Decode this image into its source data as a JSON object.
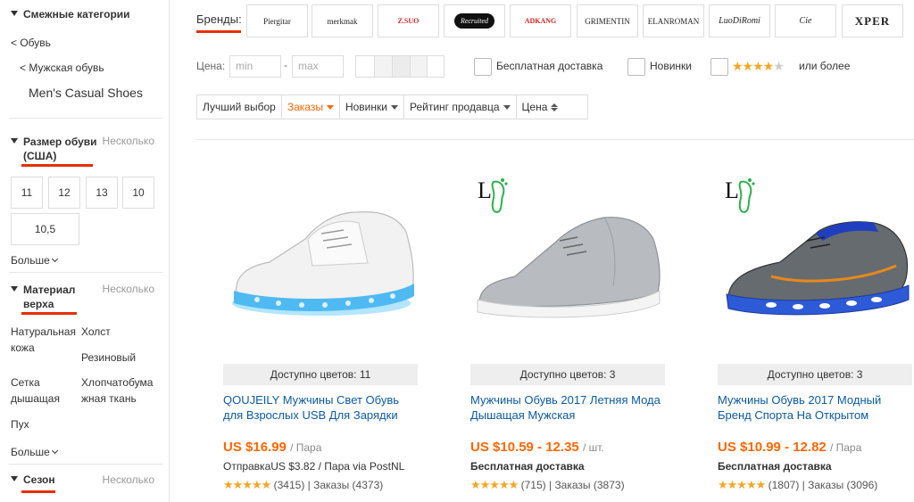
{
  "sidebar": {
    "related_title": "Смежные категории",
    "cat_shoes": "< Обувь",
    "cat_mens": "< Мужская обувь",
    "cat_casual": "Men's Casual Shoes",
    "size_title_1": "Размер обуви",
    "size_title_2": "(США)",
    "multi": "Несколько",
    "sizes": [
      "11",
      "12",
      "13",
      "10",
      "10,5"
    ],
    "more": "Больше",
    "material_title_1": "Материал",
    "material_title_2": "верха",
    "materials": [
      "Натуральная кожа",
      "Холст",
      "Резиновый",
      "Сетка дышащая",
      "Хлопчатобумажная ткань",
      "Пух"
    ],
    "season_title": "Сезон"
  },
  "filters": {
    "brands_label": "Бренды:",
    "brands": [
      "Piergitar",
      "merkmak",
      "Z.SUO",
      "Recruited",
      "ADKANG",
      "GRIMENTIN",
      "ELANROMAN",
      "LuoDiRomi",
      "Cie",
      "XPER"
    ],
    "price_label": "Цена:",
    "price_min_placeholder": "min",
    "price_max_placeholder": "max",
    "price_dash": "-",
    "free_shipping": "Бесплатная доставка",
    "new_items": "Новинки",
    "rating_or_more": "или более",
    "rating_filter_stars": 4
  },
  "sort": {
    "items": [
      "Лучший выбор",
      "Заказы",
      "Новинки",
      "Рейтинг продавца",
      "Цена"
    ],
    "active_index": 1
  },
  "products": [
    {
      "colors": "Доступно цветов: 11",
      "title": "QOUJEILY Мужчины Свет Обувь для Взрослых USB Для Зарядки",
      "price": "US $16.99",
      "unit": "/ Пара",
      "ship": "ОтправкаUS $3.82 / Пара via PostNL",
      "reviews": "(3415)",
      "orders": "Заказы (4373)"
    },
    {
      "colors": "Доступно цветов: 3",
      "title": "Мужчины Обувь 2017 Летняя Мода Дышащая Мужская",
      "price": "US $10.59 - 12.35",
      "unit": "/ шт.",
      "ship": "Бесплатная доставка",
      "reviews": "(715)",
      "orders": "Заказы (3873)"
    },
    {
      "colors": "Доступно цветов: 3",
      "title": "Мужчины Обувь 2017 Модный Бренд Спорта На Открытом",
      "price": "US $10.99 - 12.82",
      "unit": "/ Пара",
      "ship": "Бесплатная доставка",
      "reviews": "(1807)",
      "orders": "Заказы (3096)"
    }
  ],
  "colors": {
    "accent_red": "#e62e04",
    "price_orange": "#ff6600",
    "link_blue": "#0b5aa6",
    "star_gold": "#f5a623"
  }
}
